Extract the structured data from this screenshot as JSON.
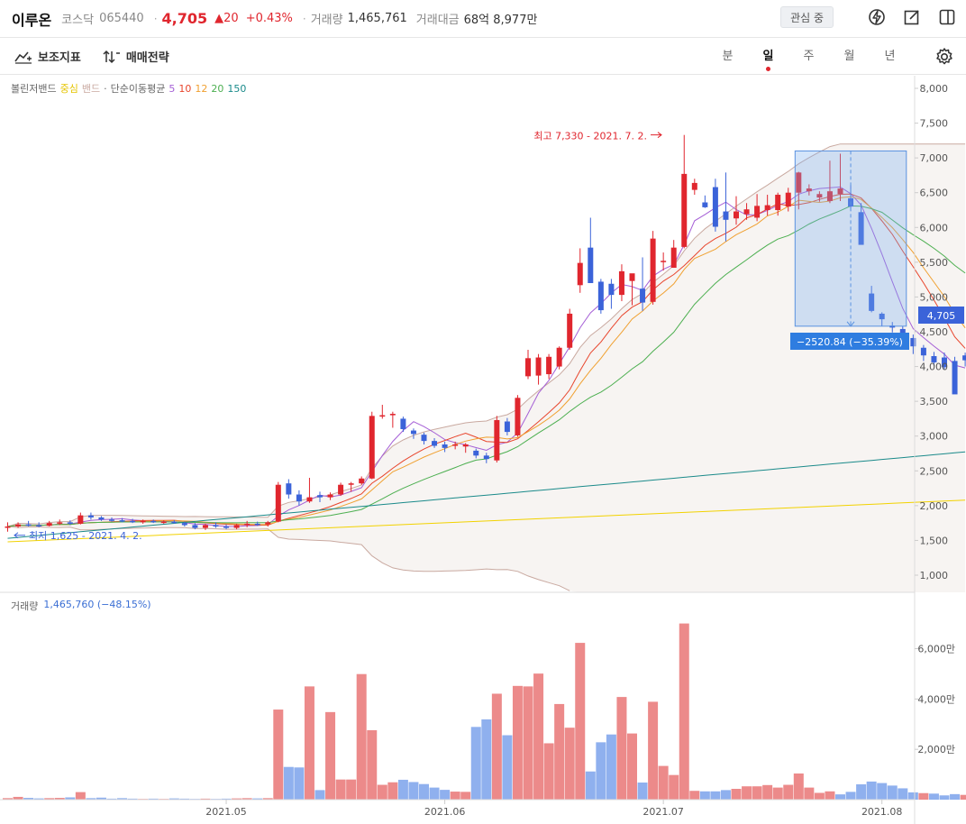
{
  "header": {
    "name": "이루온",
    "market": "코스닥",
    "code": "065440",
    "price": "4,705",
    "change": "▲20",
    "rate": "+0.43%",
    "volume_label": "거래량",
    "volume_value": "1,465,761",
    "amount_label": "거래대금",
    "amount_value": "68억 8,977만",
    "favorite_label": "관심 중"
  },
  "toolbar": {
    "indicator_label": "보조지표",
    "strategy_label": "매매전략",
    "periods": [
      "분",
      "일",
      "주",
      "월",
      "년"
    ],
    "active_period": "일"
  },
  "legend": {
    "bollinger": "볼린저밴드",
    "bollinger_center": "중심",
    "bollinger_band": "밴드",
    "sma": "단순이동평균",
    "ma_periods": [
      "5",
      "10",
      "12",
      "20",
      "150"
    ],
    "ma_colors": [
      "#a55fd6",
      "#e8452c",
      "#f0a030",
      "#4caf50",
      "#1a8a8a"
    ]
  },
  "volume_legend": {
    "label": "거래량",
    "value": "1,465,760 (−48.15%)"
  },
  "annotations": {
    "high": "최고 7,330 - 2021. 7. 2.",
    "low": "최저 1,625 - 2021. 4. 2.",
    "range_badge": "−2520.84 (−35.39%)",
    "last_price_badge": "4,705"
  },
  "chart_data": [
    {
      "type": "candlestick",
      "title": "",
      "x_labels": [
        "2021.05",
        "2021.06",
        "2021.07",
        "2021.08"
      ],
      "y_ticks": [
        "8,000",
        "7,500",
        "7,000",
        "6,500",
        "6,000",
        "5,500",
        "5,000",
        "4,500",
        "4,000",
        "3,500",
        "3,000",
        "2,500",
        "2,000",
        "1,500",
        "1,000"
      ],
      "ylim": [
        1000,
        8000
      ],
      "candles_ohlc": [
        [
          1700,
          1760,
          1625,
          1700
        ],
        [
          1700,
          1760,
          1680,
          1730
        ],
        [
          1730,
          1780,
          1700,
          1720
        ],
        [
          1720,
          1760,
          1690,
          1710
        ],
        [
          1710,
          1780,
          1700,
          1750
        ],
        [
          1750,
          1800,
          1720,
          1760
        ],
        [
          1760,
          1790,
          1720,
          1740
        ],
        [
          1740,
          1900,
          1730,
          1860
        ],
        [
          1860,
          1900,
          1800,
          1830
        ],
        [
          1830,
          1850,
          1780,
          1800
        ],
        [
          1800,
          1830,
          1770,
          1790
        ],
        [
          1790,
          1820,
          1760,
          1780
        ],
        [
          1780,
          1810,
          1750,
          1770
        ],
        [
          1770,
          1800,
          1740,
          1780
        ],
        [
          1780,
          1800,
          1750,
          1760
        ],
        [
          1760,
          1790,
          1740,
          1770
        ],
        [
          1770,
          1790,
          1740,
          1750
        ],
        [
          1750,
          1770,
          1700,
          1720
        ],
        [
          1720,
          1750,
          1660,
          1680
        ],
        [
          1680,
          1740,
          1650,
          1720
        ],
        [
          1720,
          1760,
          1680,
          1700
        ],
        [
          1700,
          1730,
          1660,
          1680
        ],
        [
          1680,
          1740,
          1660,
          1720
        ],
        [
          1720,
          1780,
          1690,
          1740
        ],
        [
          1740,
          1770,
          1710,
          1730
        ],
        [
          1730,
          1780,
          1700,
          1760
        ],
        [
          1770,
          2340,
          1760,
          2300
        ],
        [
          2320,
          2380,
          2100,
          2160
        ],
        [
          2160,
          2220,
          2000,
          2060
        ],
        [
          2060,
          2400,
          2040,
          2120
        ],
        [
          2150,
          2200,
          2050,
          2120
        ],
        [
          2120,
          2190,
          2080,
          2160
        ],
        [
          2160,
          2330,
          2140,
          2300
        ],
        [
          2300,
          2340,
          2200,
          2320
        ],
        [
          2320,
          2420,
          2300,
          2390
        ],
        [
          2390,
          3350,
          2380,
          3290
        ],
        [
          3290,
          3450,
          3250,
          3300
        ],
        [
          3300,
          3350,
          3120,
          3320
        ],
        [
          3250,
          3280,
          3060,
          3100
        ],
        [
          3080,
          3110,
          2960,
          3030
        ],
        [
          3020,
          3050,
          2880,
          2930
        ],
        [
          2930,
          2970,
          2830,
          2860
        ],
        [
          2880,
          2920,
          2770,
          2830
        ],
        [
          2860,
          2920,
          2810,
          2880
        ],
        [
          2850,
          2900,
          2760,
          2880
        ],
        [
          2790,
          2820,
          2680,
          2720
        ],
        [
          2720,
          2760,
          2610,
          2670
        ],
        [
          2650,
          3290,
          2620,
          3230
        ],
        [
          3210,
          3260,
          3010,
          3060
        ],
        [
          3010,
          3590,
          2990,
          3550
        ],
        [
          3860,
          4240,
          3820,
          4120
        ],
        [
          3870,
          4180,
          3740,
          4130
        ],
        [
          3890,
          4180,
          3820,
          4140
        ],
        [
          4000,
          4290,
          3960,
          4270
        ],
        [
          4270,
          4830,
          4240,
          4760
        ],
        [
          5170,
          5700,
          5060,
          5490
        ],
        [
          5710,
          6140,
          5450,
          5200
        ],
        [
          5220,
          5260,
          4760,
          4810
        ],
        [
          5190,
          5260,
          4830,
          5030
        ],
        [
          5030,
          5470,
          4940,
          5370
        ],
        [
          5230,
          5330,
          4880,
          5340
        ],
        [
          5120,
          5570,
          4800,
          4920
        ],
        [
          4930,
          5950,
          4890,
          5840
        ],
        [
          5510,
          5640,
          5380,
          5520
        ],
        [
          5420,
          5820,
          5420,
          5710
        ],
        [
          5720,
          7330,
          5700,
          6770
        ],
        [
          6540,
          6700,
          6470,
          6640
        ],
        [
          6360,
          6460,
          6280,
          6290
        ],
        [
          6580,
          6700,
          5940,
          6010
        ],
        [
          6230,
          6790,
          5800,
          6110
        ],
        [
          6130,
          6450,
          6040,
          6230
        ],
        [
          6190,
          6350,
          6110,
          6260
        ],
        [
          6140,
          6480,
          6090,
          6310
        ],
        [
          6250,
          6470,
          6170,
          6320
        ],
        [
          6250,
          6500,
          6170,
          6470
        ],
        [
          6300,
          6570,
          6230,
          6500
        ],
        [
          6500,
          6800,
          6260,
          6790
        ],
        [
          6520,
          6620,
          6460,
          6560
        ],
        [
          6430,
          6520,
          6370,
          6480
        ],
        [
          6380,
          6960,
          6350,
          6520
        ],
        [
          6480,
          7060,
          6380,
          6560
        ],
        [
          6420,
          6610,
          6240,
          6300
        ],
        [
          6220,
          6350,
          5900,
          5750
        ],
        [
          5050,
          5160,
          4780,
          4800
        ],
        [
          4760,
          4780,
          4580,
          4680
        ],
        [
          4590,
          4640,
          4490,
          4560
        ],
        [
          4540,
          4580,
          4370,
          4390
        ],
        [
          4410,
          4460,
          4180,
          4290
        ],
        [
          4270,
          4310,
          4080,
          4160
        ],
        [
          4150,
          4210,
          4010,
          4060
        ],
        [
          4130,
          4200,
          3960,
          3990
        ],
        [
          4080,
          4140,
          3700,
          3600
        ],
        [
          4160,
          4200,
          4000,
          4090
        ]
      ],
      "series": [
        {
          "name": "5",
          "color": "#a55fd6"
        },
        {
          "name": "10",
          "color": "#e8452c"
        },
        {
          "name": "12",
          "color": "#f0a030"
        },
        {
          "name": "20",
          "color": "#4caf50"
        },
        {
          "name": "150",
          "color": "#1a8a8a"
        }
      ]
    },
    {
      "type": "bar",
      "title": "",
      "y_ticks": [
        "6,000만",
        "4,000만",
        "2,000만"
      ],
      "ylim": [
        0,
        7200
      ],
      "values": [
        60,
        110,
        70,
        50,
        60,
        70,
        90,
        300,
        60,
        80,
        40,
        60,
        40,
        30,
        40,
        30,
        50,
        40,
        30,
        40,
        30,
        40,
        50,
        60,
        50,
        60,
        3580,
        1300,
        1280,
        4500,
        380,
        3480,
        800,
        800,
        4990,
        2760,
        590,
        690,
        790,
        700,
        620,
        480,
        390,
        320,
        310,
        2890,
        3190,
        4210,
        2560,
        4520,
        4500,
        5010,
        2240,
        3800,
        2860,
        6230,
        1120,
        2280,
        2590,
        4080,
        2630,
        680,
        3890,
        1340,
        980,
        7000,
        350,
        330,
        330,
        380,
        430,
        530,
        530,
        580,
        480,
        590,
        1040,
        480,
        270,
        330,
        210,
        310,
        610,
        720,
        660,
        560,
        450,
        290,
        260,
        240,
        170,
        220,
        190
      ],
      "up": [
        1,
        1,
        0,
        0,
        1,
        1,
        0,
        1,
        0,
        0,
        0,
        0,
        0,
        1,
        0,
        1,
        0,
        0,
        0,
        1,
        0,
        0,
        1,
        1,
        0,
        1,
        1,
        0,
        0,
        1,
        0,
        1,
        1,
        1,
        1,
        1,
        1,
        1,
        0,
        0,
        0,
        0,
        0,
        1,
        1,
        0,
        0,
        1,
        0,
        1,
        1,
        1,
        1,
        1,
        1,
        1,
        0,
        0,
        0,
        1,
        1,
        0,
        1,
        1,
        1,
        1,
        1,
        0,
        0,
        0,
        1,
        1,
        1,
        1,
        1,
        1,
        1,
        1,
        1,
        1,
        0,
        0,
        0,
        0,
        0,
        0,
        0,
        0,
        1,
        0,
        0,
        0,
        1
      ]
    }
  ]
}
